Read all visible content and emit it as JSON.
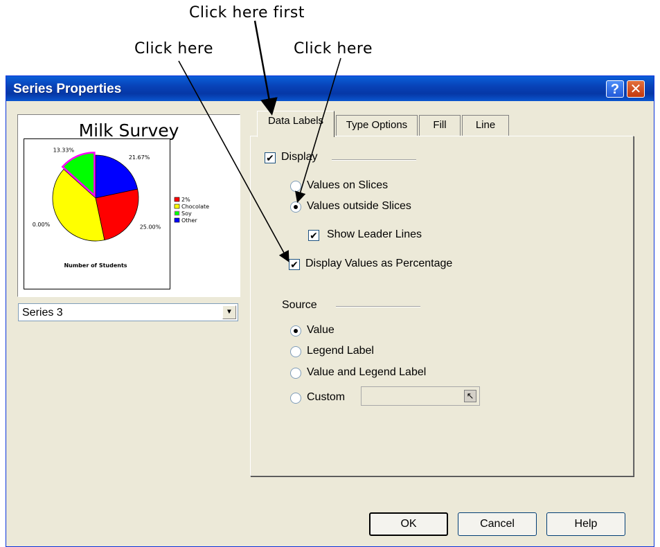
{
  "annotations": [
    "Click here first",
    "Click here",
    "Click here"
  ],
  "dialog": {
    "title": "Series Properties",
    "help_glyph": "?",
    "close_glyph": "✕"
  },
  "preview": {
    "series_selector": "Series 3"
  },
  "chart_data": {
    "type": "pie",
    "title": "Milk Survey",
    "xlabel": "Number of Students",
    "legend_position": "right",
    "categories": [
      "2%",
      "Chocolate",
      "Soy",
      "Other"
    ],
    "values": [
      25.0,
      40.0,
      13.33,
      21.67
    ],
    "data_labels": [
      "25.00%",
      "0.00%",
      "13.33%",
      "21.67%"
    ],
    "colors": [
      "#ff0000",
      "#ffff00",
      "#00ff00",
      "#0000ff"
    ],
    "highlighted_category": "Soy"
  },
  "tabs": [
    "Data Labels",
    "Type Options",
    "Fill",
    "Line"
  ],
  "active_tab": "Data Labels",
  "options": {
    "display_label": "Display",
    "display_checked": true,
    "values_on_slices": "Values on Slices",
    "values_outside_slices": "Values outside Slices",
    "show_leader_lines": "Show Leader Lines",
    "display_as_percentage": "Display Values as Percentage",
    "source_label": "Source",
    "source_value": "Value",
    "source_legend_label": "Legend Label",
    "source_value_and_legend": "Value and Legend Label",
    "source_custom": "Custom",
    "custom_picker_glyph": "↖"
  },
  "buttons": {
    "ok": "OK",
    "cancel": "Cancel",
    "help": "Help"
  }
}
